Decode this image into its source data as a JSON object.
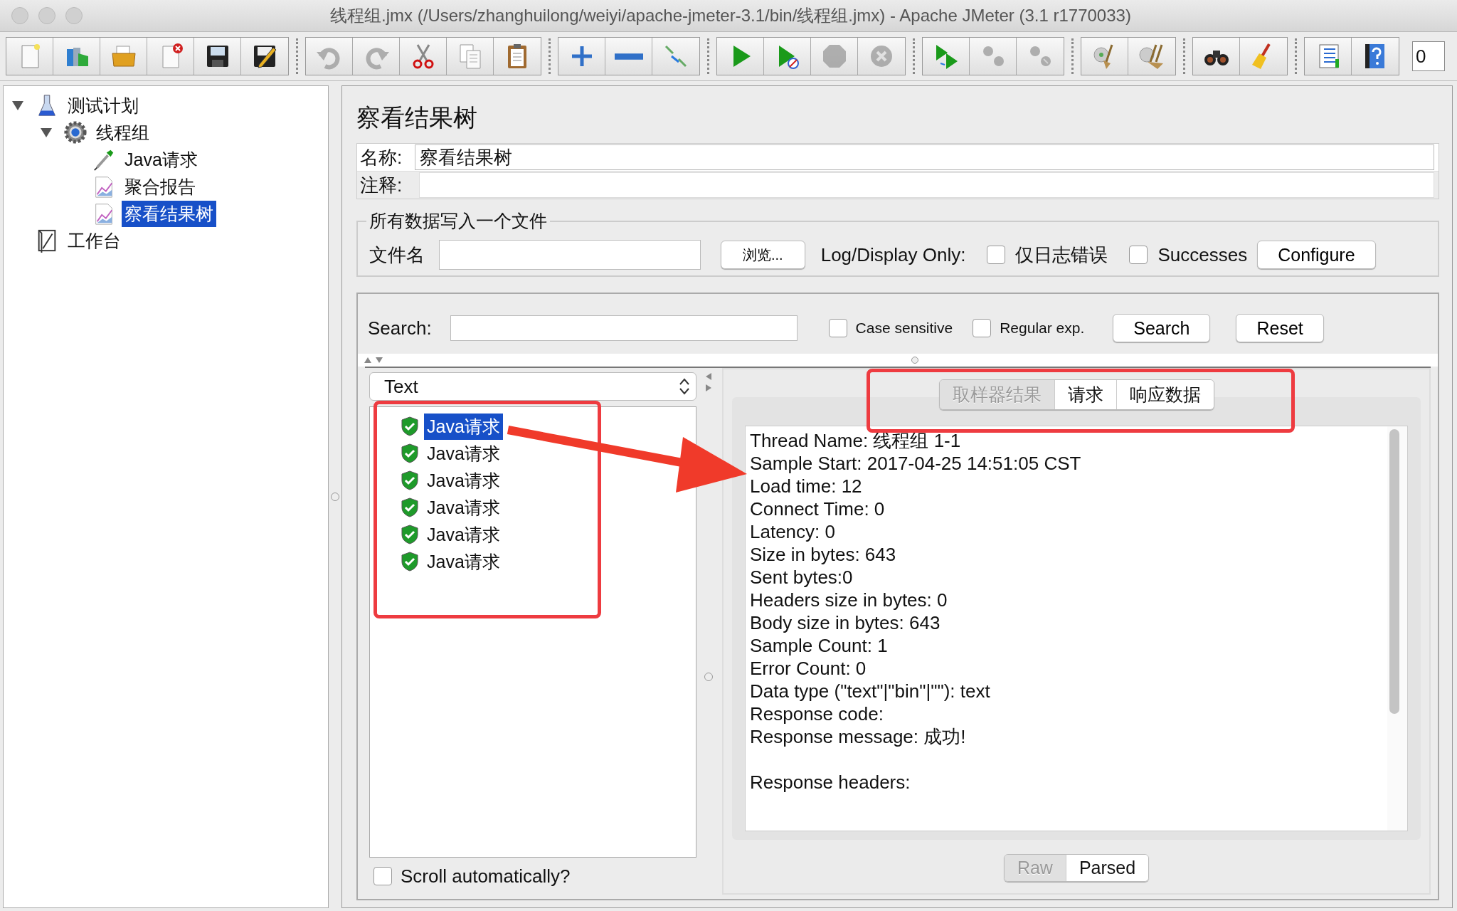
{
  "window": {
    "title": "线程组.jmx (/Users/zhanghuilong/weiyi/apache-jmeter-3.1/bin/线程组.jmx) - Apache JMeter (3.1 r1770033)"
  },
  "toolbar_groups": [
    [
      {
        "kind": "new",
        "disabled": false
      },
      {
        "kind": "templates",
        "disabled": false
      },
      {
        "kind": "open",
        "disabled": false
      },
      {
        "kind": "close",
        "disabled": false
      },
      {
        "kind": "save",
        "disabled": false
      },
      {
        "kind": "saveas",
        "disabled": false
      }
    ],
    [
      {
        "kind": "undo",
        "disabled": true
      },
      {
        "kind": "redo",
        "disabled": true
      },
      {
        "kind": "cut",
        "disabled": false
      },
      {
        "kind": "copy",
        "disabled": false
      },
      {
        "kind": "paste",
        "disabled": false
      }
    ],
    [
      {
        "kind": "expand",
        "disabled": false
      },
      {
        "kind": "collapse",
        "disabled": false
      },
      {
        "kind": "toggle",
        "disabled": false
      }
    ],
    [
      {
        "kind": "start",
        "disabled": false
      },
      {
        "kind": "start-no-pause",
        "disabled": false
      },
      {
        "kind": "stop",
        "disabled": true
      },
      {
        "kind": "shutdown",
        "disabled": true
      }
    ],
    [
      {
        "kind": "remote-start",
        "disabled": false
      },
      {
        "kind": "remote-stop",
        "disabled": true
      },
      {
        "kind": "remote-exit",
        "disabled": true
      }
    ],
    [
      {
        "kind": "clear",
        "disabled": false
      },
      {
        "kind": "clear-all",
        "disabled": false
      }
    ],
    [
      {
        "kind": "search",
        "disabled": false
      },
      {
        "kind": "reset-search",
        "disabled": false
      }
    ],
    [
      {
        "kind": "functions",
        "disabled": false
      },
      {
        "kind": "help",
        "disabled": false
      }
    ]
  ],
  "toolbar_counter": "0",
  "tree": [
    {
      "label": "测试计划",
      "kind": "plan",
      "expanded": true,
      "selected": false,
      "children": [
        {
          "label": "线程组",
          "kind": "threads",
          "expanded": true,
          "selected": false,
          "children": [
            {
              "label": "Java请求",
              "kind": "sampler",
              "selected": false
            },
            {
              "label": "聚合报告",
              "kind": "listener",
              "selected": false
            },
            {
              "label": "察看结果树",
              "kind": "listener",
              "selected": true
            }
          ]
        }
      ]
    },
    {
      "label": "工作台",
      "kind": "workbench",
      "selected": false
    }
  ],
  "panel": {
    "title": "察看结果树",
    "name_label": "名称:",
    "name_value": "察看结果树",
    "comment_label": "注释:",
    "file_group": {
      "legend": "所有数据写入一个文件",
      "filename_label": "文件名",
      "browse_button": "浏览...",
      "log_label": "Log/Display Only:",
      "checkboxes": [
        {
          "label": "仅日志错误",
          "checked": false
        },
        {
          "label": "Successes",
          "checked": false
        }
      ],
      "configure_button": "Configure"
    },
    "search": {
      "label": "Search:",
      "options": [
        {
          "label": "Case sensitive",
          "checked": false
        },
        {
          "label": "Regular exp.",
          "checked": false
        }
      ],
      "search_button": "Search",
      "reset_button": "Reset"
    },
    "renderer": "Text",
    "results": [
      {
        "label": "Java请求",
        "passed": true,
        "selected": true
      },
      {
        "label": "Java请求",
        "passed": true,
        "selected": false
      },
      {
        "label": "Java请求",
        "passed": true,
        "selected": false
      },
      {
        "label": "Java请求",
        "passed": true,
        "selected": false
      },
      {
        "label": "Java请求",
        "passed": true,
        "selected": false
      },
      {
        "label": "Java请求",
        "passed": true,
        "selected": false
      }
    ],
    "scroll_auto": {
      "label": "Scroll automatically?",
      "checked": false
    },
    "tabs": [
      {
        "label": "取样器结果",
        "selected": true
      },
      {
        "label": "请求",
        "selected": false
      },
      {
        "label": "响应数据",
        "selected": false
      }
    ],
    "lines": [
      "Thread Name: 线程组 1-1",
      "Sample Start: 2017-04-25 14:51:05 CST",
      "Load time: 12",
      "Connect Time: 0",
      "Latency: 0",
      "Size in bytes: 643",
      "Sent bytes:0",
      "Headers size in bytes: 0",
      "Body size in bytes: 643",
      "Sample Count: 1",
      "Error Count: 0",
      "Data type (\"text\"|\"bin\"|\"\"): text",
      "Response code:",
      "Response message: 成功!"
    ],
    "headers_heading": "Response headers:",
    "view_modes": [
      {
        "label": "Raw",
        "selected": true
      },
      {
        "label": "Parsed",
        "selected": false
      }
    ]
  }
}
